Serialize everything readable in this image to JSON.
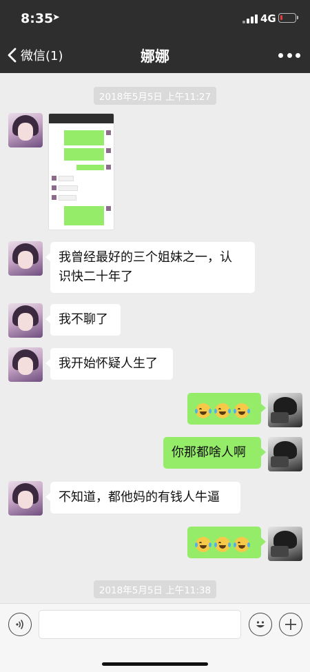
{
  "status_bar": {
    "time": "8:35",
    "network": "4G"
  },
  "nav": {
    "back_label": "微信(1)",
    "title": "娜娜"
  },
  "timestamps": [
    "2018年5月5日 上午11:27",
    "2018年5月5日 上午11:38"
  ],
  "messages": [
    {
      "side": "left",
      "type": "image"
    },
    {
      "side": "left",
      "type": "text",
      "text_line1": "我曾经最好的三个姐妹之一，认",
      "text_line2": "识快二十年了"
    },
    {
      "side": "left",
      "type": "text",
      "text": "我不聊了"
    },
    {
      "side": "left",
      "type": "text",
      "text": "我开始怀疑人生了"
    },
    {
      "side": "right",
      "type": "emoji",
      "emoji_count": 3
    },
    {
      "side": "right",
      "type": "text",
      "text": "你那都啥人啊"
    },
    {
      "side": "left",
      "type": "text",
      "text": "不知道，都他妈的有钱人牛逼"
    },
    {
      "side": "right",
      "type": "emoji",
      "emoji_count": 3
    }
  ],
  "colors": {
    "nav_bg": "#2e2e2e",
    "chat_bg": "#ededed",
    "sent_bubble": "#95ec69",
    "received_bubble": "#ffffff"
  },
  "icons": [
    "location-arrow-icon",
    "signal-icon",
    "battery-icon",
    "back-chevron-icon",
    "more-icon",
    "voice-icon",
    "emoji-icon",
    "plus-icon",
    "laugh-cry-emoji-icon"
  ]
}
